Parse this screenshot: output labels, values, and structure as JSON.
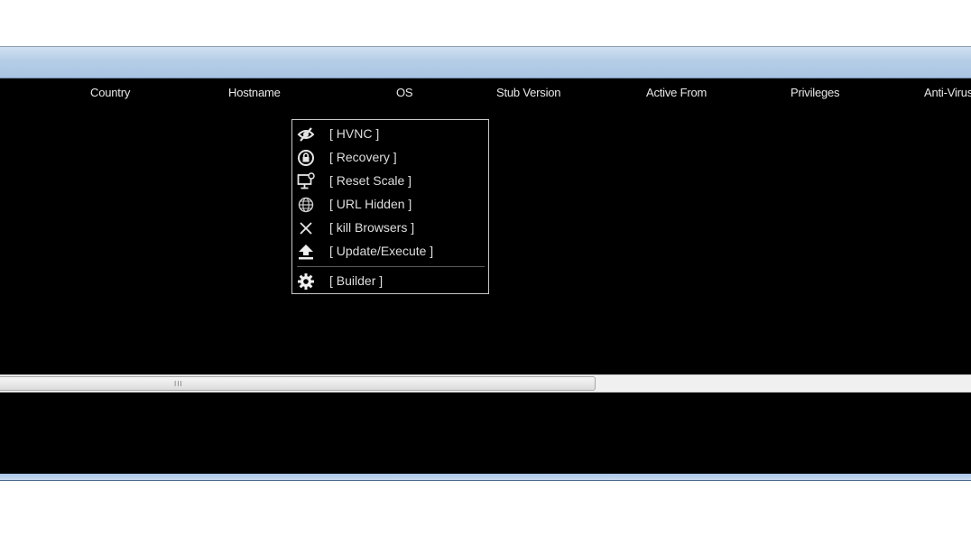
{
  "grid": {
    "columns": [
      "Country",
      "Hostname",
      "OS",
      "Stub Version",
      "Active From",
      "Privileges",
      "Anti-Virus"
    ]
  },
  "context_menu": {
    "items": [
      {
        "label": "[ HVNC ]",
        "icon": "eye-slash-icon"
      },
      {
        "label": "[ Recovery ]",
        "icon": "lock-circle-icon"
      },
      {
        "label": "[ Reset Scale ]",
        "icon": "monitor-settings-icon"
      },
      {
        "label": "[ URL Hidden ]",
        "icon": "globe-icon"
      },
      {
        "label": "[ kill Browsers ]",
        "icon": "close-x-icon"
      },
      {
        "label": "[ Update/Execute ]",
        "icon": "upload-icon"
      },
      {
        "label": "[ Builder ]",
        "icon": "gear-icon"
      }
    ]
  },
  "scrollbar": {
    "grip": "III"
  }
}
